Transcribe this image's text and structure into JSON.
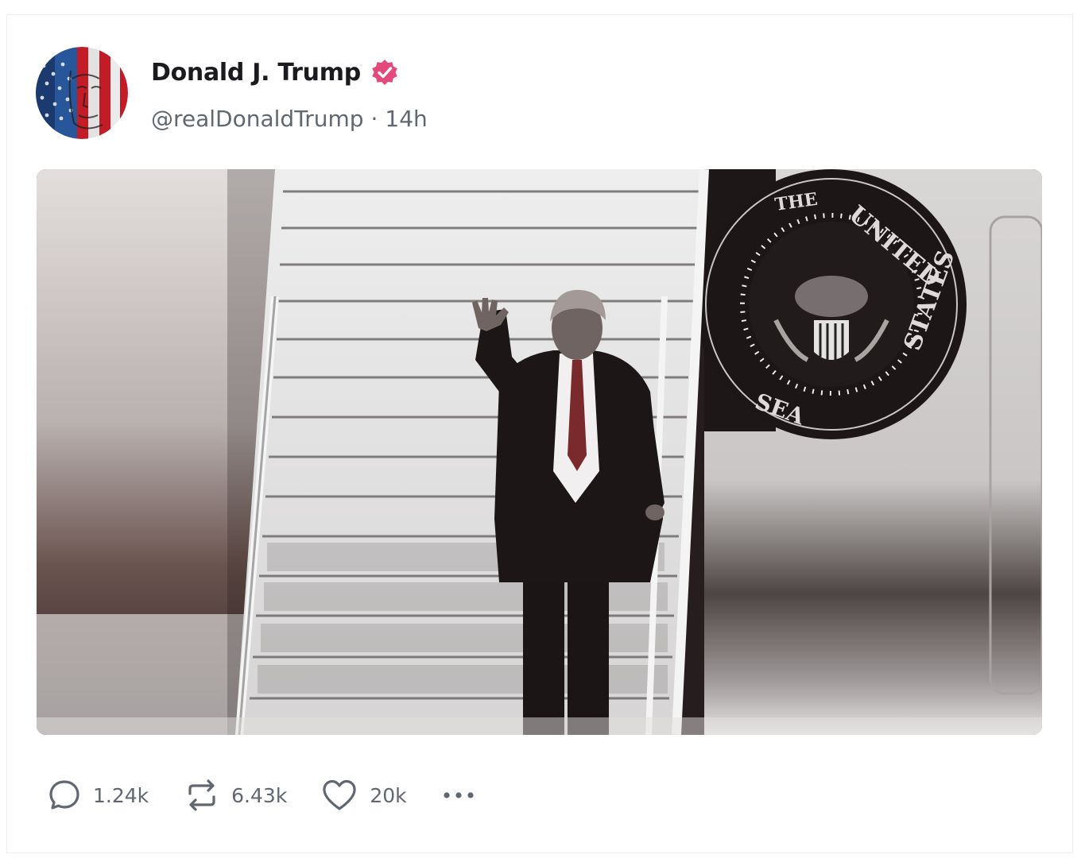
{
  "post": {
    "author": {
      "display_name": "Donald J. Trump",
      "handle": "@realDonaldTrump",
      "separator": "·",
      "time_ago": "14h",
      "verified": true,
      "verified_badge_color": "#e3497a"
    },
    "media": {
      "type": "video-still",
      "seal_text": [
        "THE",
        "UNITED",
        "STATES",
        "SEA"
      ]
    },
    "actions": {
      "replies": "1.24k",
      "reposts": "6.43k",
      "likes": "20k",
      "reply_icon": "comment-bubble-icon",
      "repost_icon": "repost-arrows-icon",
      "like_icon": "heart-icon",
      "more_icon": "ellipsis-icon"
    }
  },
  "colors": {
    "text_primary": "#1a1a1f",
    "text_secondary": "#606770",
    "border": "#eceef1",
    "accent_tie": "#7a2a2c"
  }
}
